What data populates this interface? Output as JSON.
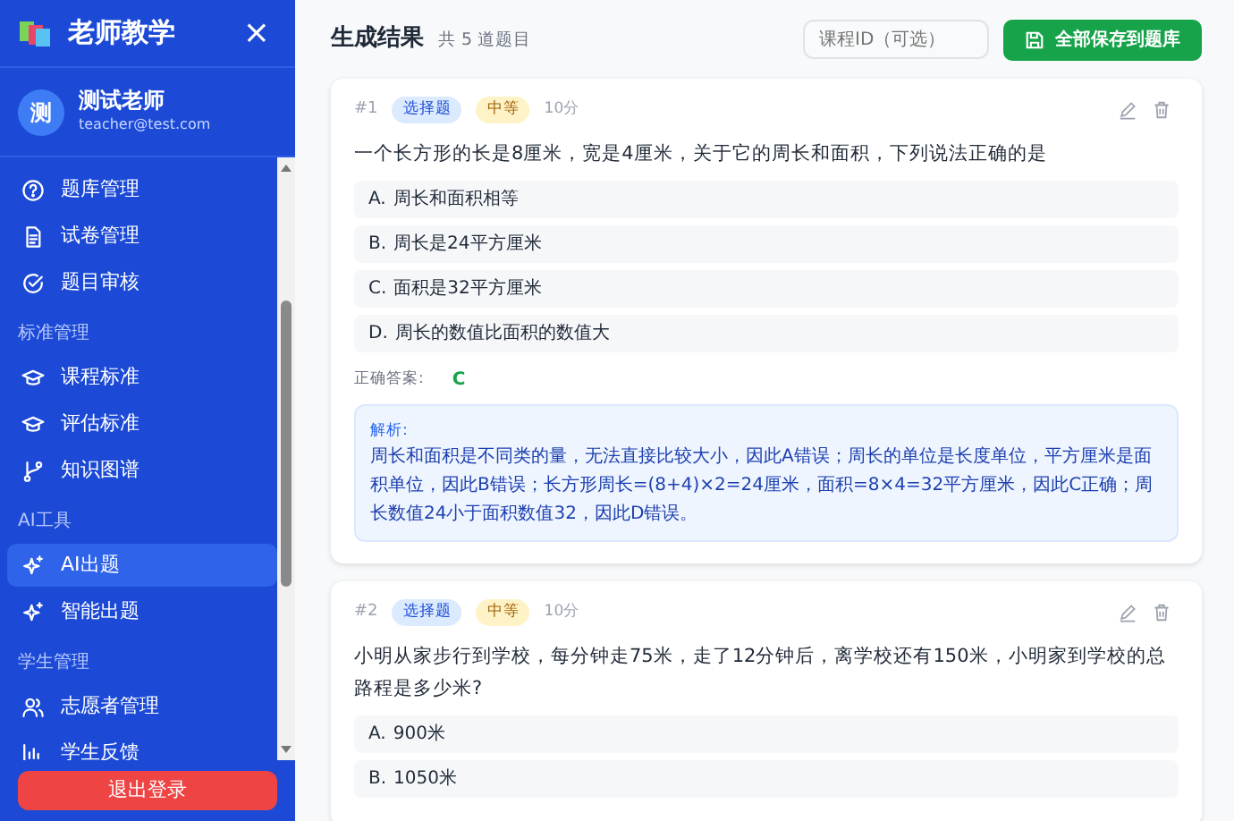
{
  "sidebar": {
    "app_title": "老师教学",
    "close": "×",
    "user": {
      "avatar": "测",
      "name": "测试老师",
      "email": "teacher@test.com"
    },
    "nav": [
      {
        "kind": "item",
        "label": "题库管理",
        "selected": false
      },
      {
        "kind": "item",
        "label": "试卷管理",
        "selected": false
      },
      {
        "kind": "item",
        "label": "题目审核",
        "selected": false
      },
      {
        "kind": "section",
        "label": "标准管理"
      },
      {
        "kind": "item",
        "label": "课程标准",
        "selected": false
      },
      {
        "kind": "item",
        "label": "评估标准",
        "selected": false
      },
      {
        "kind": "item",
        "label": "知识图谱",
        "selected": false
      },
      {
        "kind": "section",
        "label": "AI工具"
      },
      {
        "kind": "item",
        "label": "AI出题",
        "selected": true
      },
      {
        "kind": "item",
        "label": "智能出题",
        "selected": false
      },
      {
        "kind": "section",
        "label": "学生管理"
      },
      {
        "kind": "item",
        "label": "志愿者管理",
        "selected": false
      },
      {
        "kind": "item",
        "label": "学生反馈",
        "selected": false
      }
    ],
    "logout": "退出登录"
  },
  "header": {
    "title": "生成结果",
    "count": "共 5 道题目",
    "course_field": {
      "placeholder": "课程ID（可选）"
    },
    "save_all": "全部保存到题库"
  },
  "questions": [
    {
      "number": "#1",
      "type": "选择题",
      "difficulty": "中等",
      "score": "10分",
      "text": "一个长方形的长是8厘米，宽是4厘米，关于它的周长和面积，下列说法正确的是",
      "options": [
        {
          "letter": "A.",
          "text": "周长和面积相等"
        },
        {
          "letter": "B.",
          "text": "周长是24平方厘米"
        },
        {
          "letter": "C.",
          "text": "面积是32平方厘米"
        },
        {
          "letter": "D.",
          "text": "周长的数值比面积的数值大"
        }
      ],
      "answer_label": "正确答案:",
      "answer": "C",
      "explanation_label": "解析:",
      "explanation": "周长和面积是不同类的量，无法直接比较大小，因此A错误；周长的单位是长度单位，平方厘米是面积单位，因此B错误；长方形周长=(8+4)×2=24厘米，面积=8×4=32平方厘米，因此C正确；周长数值24小于面积数值32，因此D错误。"
    },
    {
      "number": "#2",
      "type": "选择题",
      "difficulty": "中等",
      "score": "10分",
      "text": "小明从家步行到学校，每分钟走75米，走了12分钟后，离学校还有150米，小明家到学校的总路程是多少米?",
      "options": [
        {
          "letter": "A.",
          "text": "900米"
        },
        {
          "letter": "B.",
          "text": "1050米"
        }
      ]
    }
  ]
}
